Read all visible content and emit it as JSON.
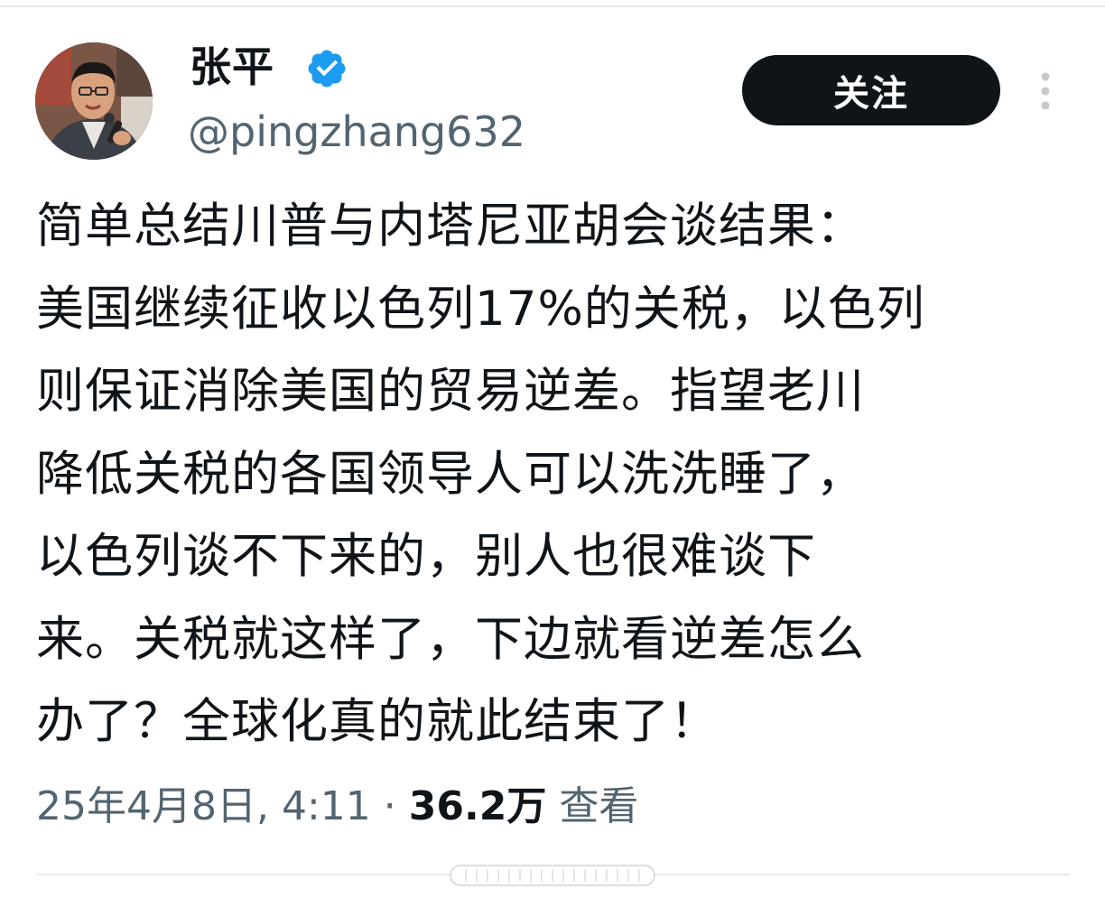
{
  "author": {
    "display_name": "张平",
    "handle": "@pingzhang632",
    "verified": true,
    "avatar_icon": "profile-photo"
  },
  "actions": {
    "follow_label": "关注",
    "more_icon": "more-vertical-icon"
  },
  "tweet": {
    "lines": [
      "简单总结川普与内塔尼亚胡会谈结果：",
      "美国继续征收以色列17%的关税，以色列",
      "则保证消除美国的贸易逆差。指望老川",
      "降低关税的各国领导人可以洗洗睡了，",
      "以色列谈不下来的，别人也很难谈下",
      "来。关税就这样了，下边就看逆差怎么",
      "办了？全球化真的就此结束了！"
    ]
  },
  "meta": {
    "timestamp": "25年4月8日, 4:11",
    "separator": "·",
    "views_count": "36.2万",
    "views_label": "查看"
  },
  "colors": {
    "text": "#0f1419",
    "secondary": "#536471",
    "verified_blue": "#1d9bf0",
    "button_bg": "#0f1419",
    "divider": "#e7e9ea"
  }
}
